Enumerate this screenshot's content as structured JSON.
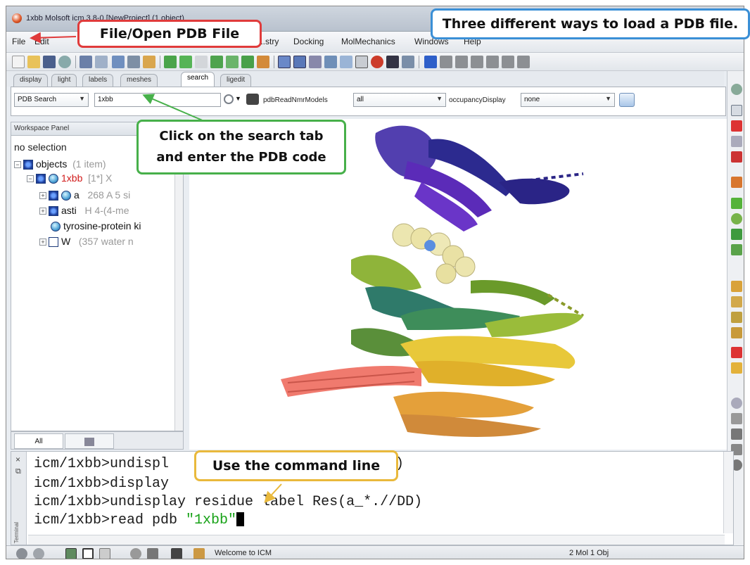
{
  "window": {
    "title": "1xbb Molsoft icm 3.8-0 [NewProject] (1 object)"
  },
  "menu": {
    "file": "File",
    "edit": "Edit",
    "chemistry": "...stry",
    "docking": "Docking",
    "molmechanics": "MolMechanics",
    "windows": "Windows",
    "help": "Help"
  },
  "tabs": [
    "display",
    "light",
    "labels",
    "meshes",
    "search",
    "ligedit"
  ],
  "active_tab": "search",
  "search": {
    "mode": "PDB Search",
    "query": "1xbb",
    "nmr_label": "pdbReadNmrModels",
    "nmr_value": "all",
    "occupancy_label": "occupancyDisplay",
    "occupancy_value": "none"
  },
  "workspace": {
    "header": "Workspace Panel",
    "selection": "no selection",
    "objects_label": "objects",
    "objects_count": "(1 item)",
    "obj_name": "1xbb",
    "obj_flags": "[1*] X",
    "chain_a_name": "a",
    "chain_a_desc": "268 A 5 si",
    "asti_name": "asti",
    "asti_desc": "H  4-(4-me",
    "protein_desc": "tyrosine-protein ki",
    "water_name": "W",
    "water_desc": "(357 water n",
    "tab_all": "All"
  },
  "terminal": {
    "vertical_label": "Terminal",
    "line1": "icm/1xbb>undispl",
    "line1_tail": "DD)",
    "line2": "icm/1xbb>display",
    "line3": "icm/1xbb>undisplay residue label Res(a_*.//DD)",
    "line4_cmd": "icm/1xbb>read pdb ",
    "line4_str": "\"1xbb\""
  },
  "status": {
    "message": "Welcome to ICM",
    "counts": "2 Mol 1 Obj"
  },
  "callouts": {
    "file_open": "File/Open PDB File",
    "three_ways": "Three different ways to load a PDB file.",
    "search_tab_l1": "Click on the search tab",
    "search_tab_l2": "and enter the PDB code",
    "command_line": "Use the command line"
  },
  "colors": {
    "callout_red": "#e03b3b",
    "callout_blue": "#3a8fd6",
    "callout_green": "#47b04a",
    "callout_yellow": "#e9b93c",
    "selected_object": "#d11b1b",
    "command_string": "#17a217"
  }
}
